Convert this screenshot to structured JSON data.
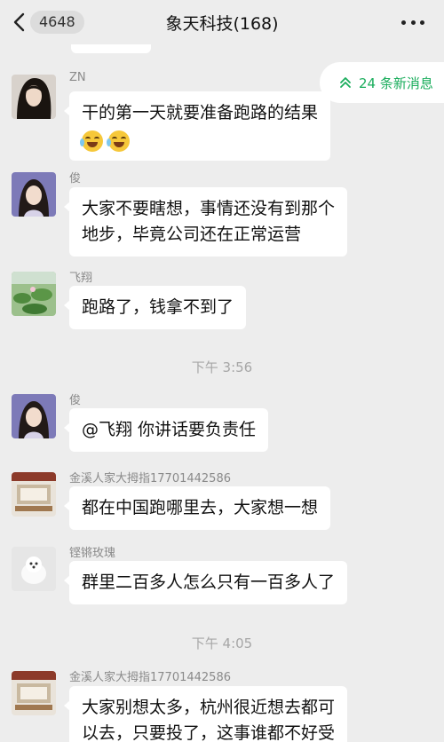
{
  "header": {
    "unread_count": "4648",
    "title": "象天科技(168)"
  },
  "new_messages_label": "24 条新消息",
  "messages": [
    {
      "sender": "ZN",
      "text": "干的第一天就要准备跑路的结果",
      "emoji": [
        "tears-of-joy",
        "tears-of-joy"
      ]
    },
    {
      "sender": "俊",
      "line1": "大家不要瞎想，事情还没有到那个",
      "line2": "地步，毕竟公司还在正常运营"
    },
    {
      "sender": "飞翔",
      "text": "跑路了，钱拿不到了"
    },
    {
      "sender": "俊",
      "text": "@飞翔 你讲话要负责任"
    },
    {
      "sender": "金溪人家大拇指17701442586",
      "text": "都在中国跑哪里去，大家想一想"
    },
    {
      "sender": "铿锵玫瑰",
      "text": "群里二百多人怎么只有一百多人了"
    },
    {
      "sender": "金溪人家大拇指17701442586",
      "line1": "大家别想太多，杭州很近想去都可",
      "line2": "以去，只要投了，这事谁都不好受"
    }
  ],
  "timestamps": [
    "下午 3:56",
    "下午 4:05"
  ],
  "colors": {
    "background": "#ededed",
    "bubble": "#ffffff",
    "accent": "#1aad5c"
  }
}
